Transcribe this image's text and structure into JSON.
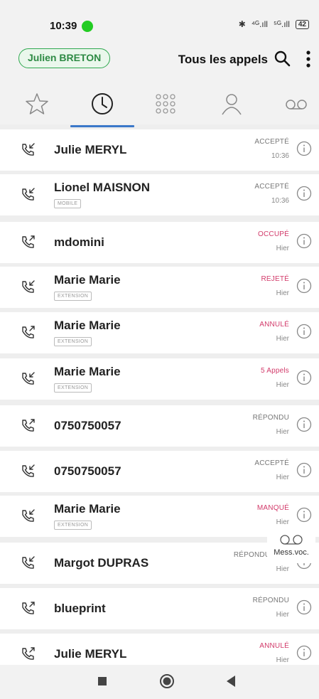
{
  "status_bar": {
    "time": "10:39",
    "signal1": "⁴ᴳ.ıll",
    "signal2": "⁵ᴳ.ıll",
    "battery": "42"
  },
  "header": {
    "user_name": "Julien BRETON",
    "title": "Tous les appels"
  },
  "tabs": [
    "favorites",
    "history",
    "keypad",
    "contacts",
    "voicemail"
  ],
  "colors": {
    "accent": "#3b78c9",
    "green": "#2fa84f",
    "red": "#d23a6a",
    "neutral": "#777777"
  },
  "calls": [
    {
      "name": "Julie MERYL",
      "tag": "",
      "status": "ACCEPTÉ",
      "status_type": "neutral",
      "when": "10:36",
      "direction": "incoming"
    },
    {
      "name": "Lionel MAISNON",
      "tag": "MOBILE",
      "status": "ACCEPTÉ",
      "status_type": "neutral",
      "when": "10:36",
      "direction": "incoming"
    },
    {
      "name": "mdomini",
      "tag": "",
      "status": "OCCUPÉ",
      "status_type": "red",
      "when": "Hier",
      "direction": "outgoing"
    },
    {
      "name": "Marie Marie",
      "tag": "EXTENSION",
      "status": "REJETÉ",
      "status_type": "red",
      "when": "Hier",
      "direction": "incoming"
    },
    {
      "name": "Marie Marie",
      "tag": "EXTENSION",
      "status": "ANNULÉ",
      "status_type": "red",
      "when": "Hier",
      "direction": "outgoing"
    },
    {
      "name": "Marie Marie",
      "tag": "EXTENSION",
      "status": "5 Appels",
      "status_type": "red",
      "when": "Hier",
      "direction": "incoming"
    },
    {
      "name": "0750750057",
      "tag": "",
      "status": "RÉPONDU",
      "status_type": "neutral",
      "when": "Hier",
      "direction": "outgoing"
    },
    {
      "name": "0750750057",
      "tag": "",
      "status": "ACCEPTÉ",
      "status_type": "neutral",
      "when": "Hier",
      "direction": "incoming"
    },
    {
      "name": "Marie Marie",
      "tag": "EXTENSION",
      "status": "MANQUÉ",
      "status_type": "red",
      "when": "Hier",
      "direction": "incoming"
    },
    {
      "name": "Margot DUPRAS",
      "tag": "",
      "status": "RÉPONDU AILLI",
      "status_type": "neutral",
      "when": "Hier",
      "direction": "incoming"
    },
    {
      "name": "blueprint",
      "tag": "",
      "status": "RÉPONDU",
      "status_type": "neutral",
      "when": "Hier",
      "direction": "outgoing"
    },
    {
      "name": "Julie MERYL",
      "tag": "",
      "status": "ANNULÉ",
      "status_type": "red",
      "when": "Hier",
      "direction": "outgoing"
    }
  ],
  "voicemail_popup": {
    "label": "Mess.voc."
  }
}
